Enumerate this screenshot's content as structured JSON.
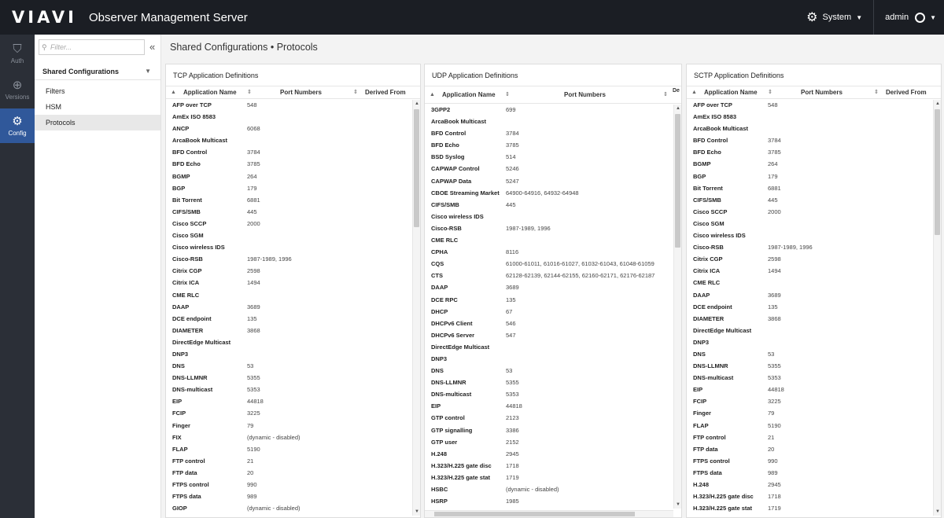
{
  "header": {
    "logo": "VIAVI",
    "title": "Observer Management Server",
    "system_label": "System",
    "user_label": "admin"
  },
  "rail": [
    {
      "label": "Auth",
      "icon": "lock-shield-icon"
    },
    {
      "label": "Versions",
      "icon": "versions-icon"
    },
    {
      "label": "Config",
      "icon": "config-icon",
      "active": true
    }
  ],
  "subnav": {
    "filter_placeholder": "Filter...",
    "section": "Shared Configurations",
    "items": [
      "Filters",
      "HSM",
      "Protocols"
    ],
    "active_item": "Protocols"
  },
  "page": {
    "breadcrumb": "Shared Configurations • Protocols"
  },
  "panels": {
    "tcp": {
      "title": "TCP Application Definitions",
      "columns": [
        "Application Name",
        "Port Numbers",
        "Derived From"
      ],
      "rows": [
        [
          "AFP over TCP",
          "548"
        ],
        [
          "AmEx ISO 8583",
          ""
        ],
        [
          "ANCP",
          "6068"
        ],
        [
          "ArcaBook Multicast",
          ""
        ],
        [
          "BFD Control",
          "3784"
        ],
        [
          "BFD Echo",
          "3785"
        ],
        [
          "BGMP",
          "264"
        ],
        [
          "BGP",
          "179"
        ],
        [
          "Bit Torrent",
          "6881"
        ],
        [
          "CIFS/SMB",
          "445"
        ],
        [
          "Cisco SCCP",
          "2000"
        ],
        [
          "Cisco SGM",
          ""
        ],
        [
          "Cisco wireless IDS",
          ""
        ],
        [
          "Cisco-RSB",
          "1987-1989, 1996"
        ],
        [
          "Citrix CGP",
          "2598"
        ],
        [
          "Citrix ICA",
          "1494"
        ],
        [
          "CME RLC",
          ""
        ],
        [
          "DAAP",
          "3689"
        ],
        [
          "DCE endpoint",
          "135"
        ],
        [
          "DIAMETER",
          "3868"
        ],
        [
          "DirectEdge Multicast",
          ""
        ],
        [
          "DNP3",
          ""
        ],
        [
          "DNS",
          "53"
        ],
        [
          "DNS-LLMNR",
          "5355"
        ],
        [
          "DNS-multicast",
          "5353"
        ],
        [
          "EIP",
          "44818"
        ],
        [
          "FCIP",
          "3225"
        ],
        [
          "Finger",
          "79"
        ],
        [
          "FIX",
          "(dynamic - disabled)"
        ],
        [
          "FLAP",
          "5190"
        ],
        [
          "FTP control",
          "21"
        ],
        [
          "FTP data",
          "20"
        ],
        [
          "FTPS control",
          "990"
        ],
        [
          "FTPS data",
          "989"
        ],
        [
          "GIOP",
          "(dynamic - disabled)"
        ]
      ]
    },
    "udp": {
      "title": "UDP Application Definitions",
      "columns": [
        "Application Name",
        "Port Numbers",
        "De Fr"
      ],
      "rows": [
        [
          "3GPP2",
          "699"
        ],
        [
          "ArcaBook Multicast",
          ""
        ],
        [
          "BFD Control",
          "3784"
        ],
        [
          "BFD Echo",
          "3785"
        ],
        [
          "BSD Syslog",
          "514"
        ],
        [
          "CAPWAP Control",
          "5246"
        ],
        [
          "CAPWAP Data",
          "5247"
        ],
        [
          "CBOE Streaming Market",
          "64900-64916, 64932-64948"
        ],
        [
          "CIFS/SMB",
          "445"
        ],
        [
          "Cisco wireless IDS",
          ""
        ],
        [
          "Cisco-RSB",
          "1987-1989, 1996"
        ],
        [
          "CME RLC",
          ""
        ],
        [
          "CPHA",
          "8116"
        ],
        [
          "CQS",
          "61000-61011, 61016-61027, 61032-61043, 61048-61059"
        ],
        [
          "CTS",
          "62128-62139, 62144-62155, 62160-62171, 62176-62187"
        ],
        [
          "DAAP",
          "3689"
        ],
        [
          "DCE RPC",
          "135"
        ],
        [
          "DHCP",
          "67"
        ],
        [
          "DHCPv6 Client",
          "546"
        ],
        [
          "DHCPv6 Server",
          "547"
        ],
        [
          "DirectEdge Multicast",
          ""
        ],
        [
          "DNP3",
          ""
        ],
        [
          "DNS",
          "53"
        ],
        [
          "DNS-LLMNR",
          "5355"
        ],
        [
          "DNS-multicast",
          "5353"
        ],
        [
          "EIP",
          "44818"
        ],
        [
          "GTP control",
          "2123"
        ],
        [
          "GTP signalling",
          "3386"
        ],
        [
          "GTP user",
          "2152"
        ],
        [
          "H.248",
          "2945"
        ],
        [
          "H.323/H.225 gate disc",
          "1718"
        ],
        [
          "H.323/H.225 gate stat",
          "1719"
        ],
        [
          "HSBC",
          "(dynamic - disabled)"
        ],
        [
          "HSRP",
          "1985"
        ]
      ]
    },
    "sctp": {
      "title": "SCTP Application Definitions",
      "columns": [
        "Application Name",
        "Port Numbers",
        "Derived From"
      ],
      "rows": [
        [
          "AFP over TCP",
          "548"
        ],
        [
          "AmEx ISO 8583",
          ""
        ],
        [
          "ArcaBook Multicast",
          ""
        ],
        [
          "BFD Control",
          "3784"
        ],
        [
          "BFD Echo",
          "3785"
        ],
        [
          "BGMP",
          "264"
        ],
        [
          "BGP",
          "179"
        ],
        [
          "Bit Torrent",
          "6881"
        ],
        [
          "CIFS/SMB",
          "445"
        ],
        [
          "Cisco SCCP",
          "2000"
        ],
        [
          "Cisco SGM",
          ""
        ],
        [
          "Cisco wireless IDS",
          ""
        ],
        [
          "Cisco-RSB",
          "1987-1989, 1996"
        ],
        [
          "Citrix CGP",
          "2598"
        ],
        [
          "Citrix ICA",
          "1494"
        ],
        [
          "CME RLC",
          ""
        ],
        [
          "DAAP",
          "3689"
        ],
        [
          "DCE endpoint",
          "135"
        ],
        [
          "DIAMETER",
          "3868"
        ],
        [
          "DirectEdge Multicast",
          ""
        ],
        [
          "DNP3",
          ""
        ],
        [
          "DNS",
          "53"
        ],
        [
          "DNS-LLMNR",
          "5355"
        ],
        [
          "DNS-multicast",
          "5353"
        ],
        [
          "EIP",
          "44818"
        ],
        [
          "FCIP",
          "3225"
        ],
        [
          "Finger",
          "79"
        ],
        [
          "FLAP",
          "5190"
        ],
        [
          "FTP control",
          "21"
        ],
        [
          "FTP data",
          "20"
        ],
        [
          "FTPS control",
          "990"
        ],
        [
          "FTPS data",
          "989"
        ],
        [
          "H.248",
          "2945"
        ],
        [
          "H.323/H.225 gate disc",
          "1718"
        ],
        [
          "H.323/H.225 gate stat",
          "1719"
        ]
      ]
    }
  }
}
